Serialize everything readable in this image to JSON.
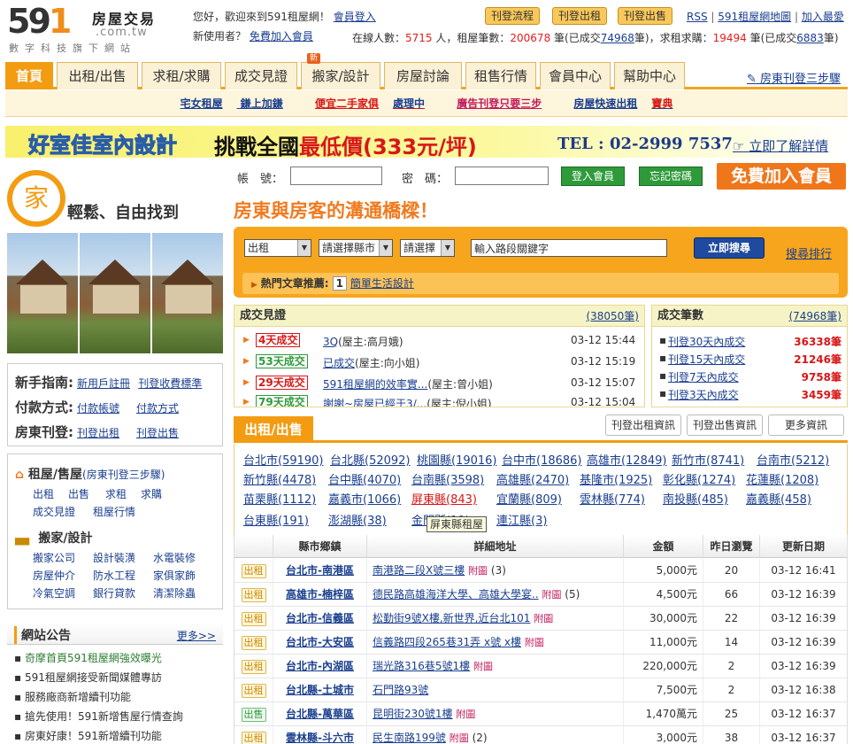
{
  "logo": {
    "num_a": "59",
    "num_b": "1",
    "cn": "房屋交易",
    "domain": ".com.tw",
    "sub": "數字科技旗下網站"
  },
  "header": {
    "welcome": "您好，歡迎來到591租屋網！",
    "login_link": "會員登入",
    "new_user": "新使用者？",
    "free_join": "免費加入會員",
    "buttons": [
      "刊登流程",
      "刊登出租",
      "刊登出售"
    ],
    "links": [
      "RSS",
      "591租屋網地圖",
      "加入最愛"
    ],
    "stats": {
      "online_label": "在線人數：",
      "online": "5715",
      "rent_label": " 人，租屋筆數：",
      "rent": "200678",
      "deal_label": " 筆(已成交",
      "deal": "74968",
      "want_label": "筆)，求租求購：",
      "want": "19494",
      "want_deal_label": " 筆(已成交",
      "want_deal": "6883",
      "end": "筆)"
    }
  },
  "nav": {
    "tabs": [
      "首頁",
      "出租/出售",
      "求租/求購",
      "成交見證",
      "搬家/設計",
      "房屋討論",
      "租售行情",
      "會員中心",
      "幫助中心"
    ],
    "new_badge": "新",
    "post_link": "房東刊登三步驟"
  },
  "subnav": [
    {
      "a": "宅女租屋",
      "b": " 鎌上加鎌",
      "color": "#1a3f8f"
    },
    {
      "a": "便宜二手家俱",
      "b": "處理中",
      "color": "#d91616"
    },
    {
      "a": "廣告刊登只要三步",
      "b": "",
      "color": "#c2185b"
    },
    {
      "a": "房屋快速出租",
      "b": "寶典",
      "color": "#1a3f8f"
    }
  ],
  "banner": {
    "brand": "好室佳室內設計",
    "slogan_a": "挑戰全國",
    "slogan_b": "最低價",
    "slogan_c": "(333元/坪)",
    "tel": "TEL : 02-2999 7537",
    "link": "立即了解詳情"
  },
  "login": {
    "acct_label": "帳　號：",
    "pwd_label": "密　碼：",
    "login_btn": "登入會員",
    "forgot_btn": "忘記密碼",
    "join_btn": "免費加入會員"
  },
  "tagline": {
    "icon": "家",
    "left": "輕鬆、自由找到",
    "main": "房東與房客的溝通橋樑！"
  },
  "search": {
    "sel1": "出租",
    "sel2": "請選擇縣市",
    "sel3": "請選擇",
    "keyword": "輸入路段關鍵字",
    "btn": "立即搜尋",
    "rank": "搜尋排行",
    "hot_label": "熱門文章推薦:",
    "hot_num": "1",
    "hot_title": "簡單生活設計"
  },
  "guide": {
    "rows": [
      {
        "label": "新手指南:",
        "links": [
          "新用戶註冊",
          "刊登收費標準"
        ]
      },
      {
        "label": "付款方式:",
        "links": [
          "付款帳號",
          "付款方式"
        ]
      },
      {
        "label": "房東刊登:",
        "links": [
          "刊登出租",
          "刊登出售"
        ]
      }
    ]
  },
  "cats": {
    "rent_title": "租屋/售屋",
    "rent_sub": "(房東刊登三步驟)",
    "rent_links": [
      "出租",
      "出售",
      "求租",
      "求購",
      "成交見證",
      "租屋行情"
    ],
    "move_title": "搬家/設計",
    "move_links": [
      "搬家公司",
      "設計裝潢",
      "水電裝修",
      "房屋仲介",
      "防水工程",
      "家俱家飾",
      "冷氣空調",
      "銀行貸款",
      "清潔除蟲"
    ]
  },
  "announce": {
    "title": "網站公告",
    "more": "更多>>",
    "items": [
      "奇摩首頁591租屋網強效曝光",
      "591租屋網接受新聞媒體專訪",
      "服務廠商新增續刊功能",
      "搶先使用！591新增售屋行情查詢",
      "房東好康！591新增續刊功能"
    ]
  },
  "deals": {
    "title": "成交見證",
    "count": "(38050筆)",
    "rows": [
      {
        "badge": "4天成交",
        "color": "r",
        "title": "3Q",
        "who": "(屋主:高月娥)",
        "date": "03-12 15:44"
      },
      {
        "badge": "53天成交",
        "color": "g",
        "title": "已成交",
        "who": "(屋主:向小姐)",
        "date": "03-12 15:19"
      },
      {
        "badge": "29天成交",
        "color": "r",
        "title": "591租屋網的效率實...",
        "who": "(屋主:曾小姐)",
        "date": "03-12 15:07"
      },
      {
        "badge": "79天成交",
        "color": "g",
        "title": "謝謝~房屋已經于3/...",
        "who": "(屋主:倪小姐)",
        "date": "03-12 15:04"
      }
    ]
  },
  "deal_counts": {
    "title": "成交筆數",
    "count": "(74968筆)",
    "rows": [
      {
        "label": "刊登30天內成交",
        "value": "36338筆"
      },
      {
        "label": "刊登15天內成交",
        "value": "21246筆"
      },
      {
        "label": "刊登7天內成交",
        "value": "9758筆"
      },
      {
        "label": "刊登3天內成交",
        "value": "3459筆"
      }
    ]
  },
  "listing": {
    "tab": "出租/出售",
    "buttons": [
      "刊登出租資訊",
      "刊登出售資訊",
      "更多資訊"
    ],
    "regions": [
      [
        "台北市(59190)",
        "台北縣(52092)",
        "桃園縣(19016)",
        "台中市(18686)",
        "高雄市(12849)",
        "新竹市(8741)",
        "台南市(5212)"
      ],
      [
        "新竹縣(4478)",
        "台中縣(4070)",
        "台南縣(3598)",
        "高雄縣(2470)",
        "基隆市(1925)",
        "彰化縣(1274)",
        "花蓮縣(1208)"
      ],
      [
        "苗栗縣(1112)",
        "嘉義市(1066)",
        "屏東縣(843)",
        "宜蘭縣(809)",
        "雲林縣(774)",
        "南投縣(485)",
        "嘉義縣(458)"
      ],
      [
        "台東縣(191)",
        "澎湖縣(38)",
        "金門縣(19)",
        "連江縣(3)"
      ]
    ],
    "tooltip": "屏東縣租屋",
    "headers": [
      "",
      "縣市鄉鎮",
      "詳細地址",
      "金額",
      "昨日瀏覽",
      "更新日期"
    ],
    "rows": [
      {
        "type": "出租",
        "kind": "rent",
        "loc": "台北市-南港區",
        "addr": "南港路二段X號三樓",
        "att": "附圖",
        "n": "(3)",
        "price": "5,000元",
        "views": "20",
        "date": "03-12 16:41"
      },
      {
        "type": "出租",
        "kind": "rent",
        "loc": "高雄市-楠梓區",
        "addr": "德民路高雄海洋大學、高雄大學宴..",
        "att": "附圖",
        "n": "(5)",
        "price": "4,500元",
        "views": "66",
        "date": "03-12 16:39"
      },
      {
        "type": "出租",
        "kind": "rent",
        "loc": "台北市-信義區",
        "addr": "松勤街9號X樓,新世界,近台北101",
        "att": "附圖",
        "n": "",
        "price": "30,000元",
        "views": "22",
        "date": "03-12 16:39"
      },
      {
        "type": "出租",
        "kind": "rent",
        "loc": "台北市-大安區",
        "addr": "信義路四段265巷31弄 x號 x樓",
        "att": "附圖",
        "n": "",
        "price": "11,000元",
        "views": "14",
        "date": "03-12 16:39"
      },
      {
        "type": "出租",
        "kind": "rent",
        "loc": "台北市-內湖區",
        "addr": "瑞光路316巷5號1樓",
        "att": "附圖",
        "n": "",
        "price": "220,000元",
        "views": "2",
        "date": "03-12 16:39"
      },
      {
        "type": "出租",
        "kind": "rent",
        "loc": "台北縣-土城市",
        "addr": "石門路93號",
        "att": "",
        "n": "",
        "price": "7,500元",
        "views": "2",
        "date": "03-12 16:38"
      },
      {
        "type": "出售",
        "kind": "sale",
        "loc": "台北縣-萬華區",
        "addr": "昆明街230號1樓",
        "att": "附圖",
        "n": "",
        "price": "1,470萬元",
        "views": "25",
        "date": "03-12 16:37"
      },
      {
        "type": "出租",
        "kind": "rent",
        "loc": "雲林縣-斗六市",
        "addr": "民生南路199號",
        "att": "附圖",
        "n": "(2)",
        "price": "3,000元",
        "views": "38",
        "date": "03-12 16:37"
      }
    ]
  }
}
